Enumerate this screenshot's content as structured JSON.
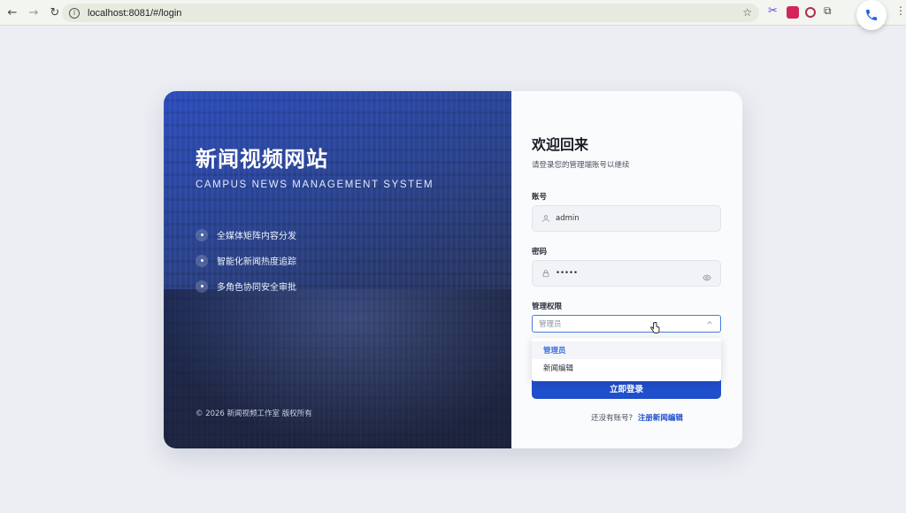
{
  "browser": {
    "url": "localhost:8081/#/login",
    "back_glyph": "←",
    "forward_glyph": "→",
    "reload_glyph": "↻",
    "info_glyph": "i",
    "star_glyph": "☆",
    "menu_glyph": "⋮",
    "puzzle_glyph": "⧉",
    "scissors_glyph": "✂"
  },
  "icons": {
    "back": "back-arrow-icon",
    "forward": "forward-arrow-icon",
    "reload": "reload-icon",
    "bookmark": "star-icon",
    "user": "user-icon",
    "lock": "lock-icon",
    "eye": "eye-icon",
    "chevron": "chevron-up-icon",
    "phone": "phone-icon"
  },
  "colors": {
    "primary": "#1f4fcc",
    "panel_start": "#2c4dbb",
    "panel_end": "#252e4d",
    "page_bg": "#eceef3"
  },
  "brand": {
    "title": "新闻视频网站",
    "subtitle": "CAMPUS NEWS MANAGEMENT SYSTEM",
    "features": [
      "全媒体矩阵内容分发",
      "智能化新闻热度追踪",
      "多角色协同安全审批"
    ],
    "copyright": "© 2026 新闻视频工作室 版权所有"
  },
  "login": {
    "heading": "欢迎回来",
    "subheading": "请登录您的管理端账号以继续",
    "account_label": "账号",
    "account_value": "admin",
    "password_label": "密码",
    "password_value": "•••••",
    "role_label": "管理权限",
    "role_placeholder": "管理员",
    "role_options": [
      "管理员",
      "新闻编辑"
    ],
    "submit_label": "立即登录",
    "register_prompt": "还没有账号?",
    "register_link": "注册新闻编辑"
  }
}
